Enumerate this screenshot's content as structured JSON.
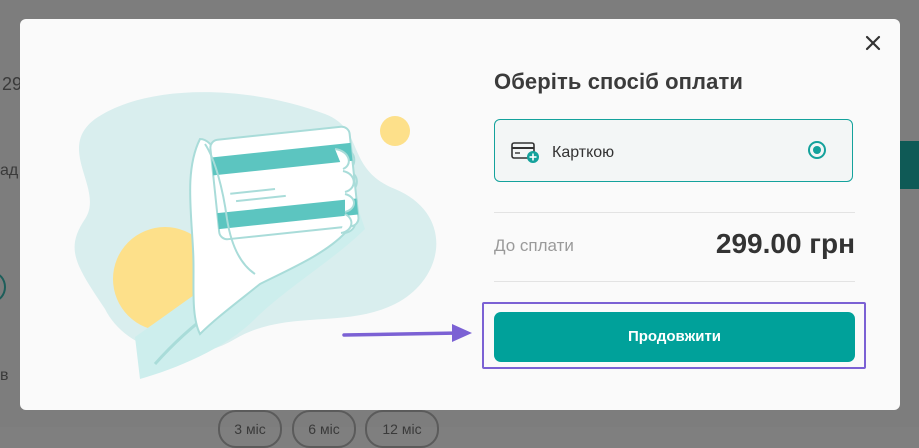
{
  "background_page": {
    "price_fragment": "29",
    "label_fragment_1": "ад",
    "label_fragment_2": "в",
    "pills": [
      "3 міс",
      "6 міс",
      "12 міс"
    ]
  },
  "modal": {
    "title": "Оберіть спосіб оплати",
    "payment_option": {
      "label": "Карткою",
      "icon": "card-add-icon",
      "selected": true
    },
    "total": {
      "label": "До сплати",
      "value": "299.00 грн"
    },
    "continue_button": {
      "label": "Продовжити"
    },
    "close_icon": "close-icon"
  },
  "colors": {
    "accent": "#00a19a",
    "highlight": "#7b61d4",
    "overlay": "#7f7f7f"
  }
}
